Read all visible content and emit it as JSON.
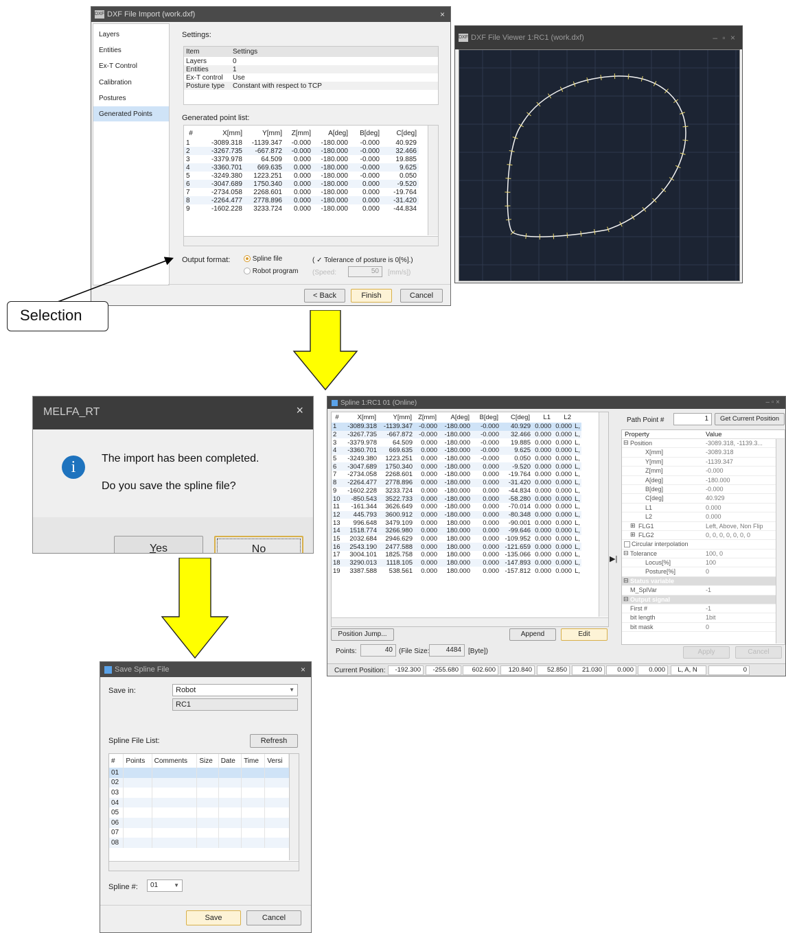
{
  "dxf_import": {
    "title": "DXF File Import (work.dxf)",
    "title_icon": "DXF",
    "close": "×",
    "nav": [
      "Layers",
      "Entities",
      "Ex-T Control",
      "Calibration",
      "Postures",
      "Generated Points"
    ],
    "settings_label": "Settings:",
    "settings_headers": [
      "Item",
      "Settings"
    ],
    "settings_rows": [
      [
        "Layers",
        "0"
      ],
      [
        "Entities",
        "1"
      ],
      [
        "Ex-T control",
        "Use"
      ],
      [
        "Posture type",
        "Constant with respect to TCP"
      ]
    ],
    "point_list_label": "Generated point list:",
    "point_headers": [
      "#",
      "X[mm]",
      "Y[mm]",
      "Z[mm]",
      "A[deg]",
      "B[deg]",
      "C[deg]"
    ],
    "point_rows": [
      [
        "1",
        "-3089.318",
        "-1139.347",
        "-0.000",
        "-180.000",
        "-0.000",
        "40.929"
      ],
      [
        "2",
        "-3267.735",
        "-667.872",
        "-0.000",
        "-180.000",
        "-0.000",
        "32.466"
      ],
      [
        "3",
        "-3379.978",
        "64.509",
        "0.000",
        "-180.000",
        "-0.000",
        "19.885"
      ],
      [
        "4",
        "-3360.701",
        "669.635",
        "0.000",
        "-180.000",
        "-0.000",
        "9.625"
      ],
      [
        "5",
        "-3249.380",
        "1223.251",
        "0.000",
        "-180.000",
        "-0.000",
        "0.050"
      ],
      [
        "6",
        "-3047.689",
        "1750.340",
        "0.000",
        "-180.000",
        "0.000",
        "-9.520"
      ],
      [
        "7",
        "-2734.058",
        "2268.601",
        "0.000",
        "-180.000",
        "0.000",
        "-19.764"
      ],
      [
        "8",
        "-2264.477",
        "2778.896",
        "0.000",
        "-180.000",
        "0.000",
        "-31.420"
      ],
      [
        "9",
        "-1602.228",
        "3233.724",
        "0.000",
        "-180.000",
        "0.000",
        "-44.834"
      ]
    ],
    "output_format_label": "Output format:",
    "option_spline": "Spline file",
    "option_robot": "Robot program",
    "tolerance_label": "( ✓ Tolerance of posture is 0[%].)",
    "speed_label": "(Speed:",
    "speed_value": "50",
    "speed_unit": "[mm/s])",
    "back": "< Back",
    "finish": "Finish",
    "cancel": "Cancel"
  },
  "selection_callout": "Selection",
  "viewer": {
    "title": "DXF File Viewer 1:RC1 (work.dxf)",
    "title_icon": "DXF",
    "controls": "–  ▫  ×"
  },
  "melfa": {
    "title": "MELFA_RT",
    "close": "×",
    "info_glyph": "i",
    "message1": "The import has been completed.",
    "message2": "Do you save the spline file?",
    "yes_key": "Y",
    "yes_rest": "es",
    "no_key": "N",
    "no_rest": "o"
  },
  "spline": {
    "title": "Spline 1:RC1 01 (Online)",
    "controls": "–  ▫  ×",
    "headers": [
      "#",
      "X[mm]",
      "Y[mm]",
      "Z[mm]",
      "A[deg]",
      "B[deg]",
      "C[deg]",
      "L1",
      "L2",
      ""
    ],
    "rows": [
      [
        "1",
        "-3089.318",
        "-1139.347",
        "-0.000",
        "-180.000",
        "-0.000",
        "40.929",
        "0.000",
        "0.000",
        "L,"
      ],
      [
        "2",
        "-3267.735",
        "-667.872",
        "-0.000",
        "-180.000",
        "-0.000",
        "32.466",
        "0.000",
        "0.000",
        "L,"
      ],
      [
        "3",
        "-3379.978",
        "64.509",
        "0.000",
        "-180.000",
        "-0.000",
        "19.885",
        "0.000",
        "0.000",
        "L,"
      ],
      [
        "4",
        "-3360.701",
        "669.635",
        "0.000",
        "-180.000",
        "-0.000",
        "9.625",
        "0.000",
        "0.000",
        "L,"
      ],
      [
        "5",
        "-3249.380",
        "1223.251",
        "0.000",
        "-180.000",
        "-0.000",
        "0.050",
        "0.000",
        "0.000",
        "L,"
      ],
      [
        "6",
        "-3047.689",
        "1750.340",
        "0.000",
        "-180.000",
        "0.000",
        "-9.520",
        "0.000",
        "0.000",
        "L,"
      ],
      [
        "7",
        "-2734.058",
        "2268.601",
        "0.000",
        "-180.000",
        "0.000",
        "-19.764",
        "0.000",
        "0.000",
        "L,"
      ],
      [
        "8",
        "-2264.477",
        "2778.896",
        "0.000",
        "-180.000",
        "0.000",
        "-31.420",
        "0.000",
        "0.000",
        "L,"
      ],
      [
        "9",
        "-1602.228",
        "3233.724",
        "0.000",
        "-180.000",
        "0.000",
        "-44.834",
        "0.000",
        "0.000",
        "L,"
      ],
      [
        "10",
        "-850.543",
        "3522.733",
        "0.000",
        "-180.000",
        "0.000",
        "-58.280",
        "0.000",
        "0.000",
        "L,"
      ],
      [
        "11",
        "-161.344",
        "3626.649",
        "0.000",
        "-180.000",
        "0.000",
        "-70.014",
        "0.000",
        "0.000",
        "L,"
      ],
      [
        "12",
        "445.793",
        "3600.912",
        "0.000",
        "-180.000",
        "0.000",
        "-80.348",
        "0.000",
        "0.000",
        "L,"
      ],
      [
        "13",
        "996.648",
        "3479.109",
        "0.000",
        "180.000",
        "0.000",
        "-90.001",
        "0.000",
        "0.000",
        "L,"
      ],
      [
        "14",
        "1518.774",
        "3266.980",
        "0.000",
        "180.000",
        "0.000",
        "-99.646",
        "0.000",
        "0.000",
        "L,"
      ],
      [
        "15",
        "2032.684",
        "2946.629",
        "0.000",
        "180.000",
        "0.000",
        "-109.952",
        "0.000",
        "0.000",
        "L,"
      ],
      [
        "16",
        "2543.190",
        "2477.588",
        "0.000",
        "180.000",
        "0.000",
        "-121.659",
        "0.000",
        "0.000",
        "L,"
      ],
      [
        "17",
        "3004.101",
        "1825.758",
        "0.000",
        "180.000",
        "0.000",
        "-135.066",
        "0.000",
        "0.000",
        "L,"
      ],
      [
        "18",
        "3290.013",
        "1118.105",
        "0.000",
        "180.000",
        "0.000",
        "-147.893",
        "0.000",
        "0.000",
        "L,"
      ],
      [
        "19",
        "3387.588",
        "538.561",
        "0.000",
        "180.000",
        "0.000",
        "-157.812",
        "0.000",
        "0.000",
        "L,"
      ]
    ],
    "position_jump": "Position Jump...",
    "append": "Append",
    "edit": "Edit",
    "points_label": "Points:",
    "points_value": "40",
    "file_size_label": "(File Size:",
    "file_size_value": "4484",
    "file_size_unit": "[Byte])",
    "path_point_label": "Path Point #",
    "path_point_value": "1",
    "get_current_position": "Get Current Position",
    "prop_headers": [
      "Property",
      "Value"
    ],
    "properties": [
      {
        "sign": "⊟",
        "name": "Position",
        "value": "-3089.318, -1139.3...",
        "indent": 0,
        "kind": "row"
      },
      {
        "sign": "",
        "name": "X[mm]",
        "value": "-3089.318",
        "indent": 2,
        "kind": "row"
      },
      {
        "sign": "",
        "name": "Y[mm]",
        "value": "-1139.347",
        "indent": 2,
        "kind": "row"
      },
      {
        "sign": "",
        "name": "Z[mm]",
        "value": "-0.000",
        "indent": 2,
        "kind": "row"
      },
      {
        "sign": "",
        "name": "A[deg]",
        "value": "-180.000",
        "indent": 2,
        "kind": "row"
      },
      {
        "sign": "",
        "name": "B[deg]",
        "value": "-0.000",
        "indent": 2,
        "kind": "row"
      },
      {
        "sign": "",
        "name": "C[deg]",
        "value": "40.929",
        "indent": 2,
        "kind": "row"
      },
      {
        "sign": "",
        "name": "L1",
        "value": "0.000",
        "indent": 2,
        "kind": "row"
      },
      {
        "sign": "",
        "name": "L2",
        "value": "0.000",
        "indent": 2,
        "kind": "row"
      },
      {
        "sign": "⊞",
        "name": "FLG1",
        "value": "Left, Above, Non Flip",
        "indent": 1,
        "kind": "row"
      },
      {
        "sign": "⊞",
        "name": "FLG2",
        "value": "0, 0, 0, 0, 0, 0, 0",
        "indent": 1,
        "kind": "row"
      },
      {
        "sign": "",
        "name": "Circular interpolation",
        "value": "",
        "indent": 0,
        "kind": "check"
      },
      {
        "sign": "⊟",
        "name": "Tolerance",
        "value": "100, 0",
        "indent": 0,
        "kind": "row"
      },
      {
        "sign": "",
        "name": "Locus[%]",
        "value": "100",
        "indent": 2,
        "kind": "row"
      },
      {
        "sign": "",
        "name": "Posture[%]",
        "value": "0",
        "indent": 2,
        "kind": "row"
      },
      {
        "sign": "⊟",
        "name": "Status variable",
        "value": "",
        "indent": 0,
        "kind": "cat"
      },
      {
        "sign": "",
        "name": "M_SplVar",
        "value": "-1",
        "indent": 1,
        "kind": "row"
      },
      {
        "sign": "⊟",
        "name": "Output signal",
        "value": "",
        "indent": 0,
        "kind": "cat"
      },
      {
        "sign": "",
        "name": "First #",
        "value": "-1",
        "indent": 1,
        "kind": "row"
      },
      {
        "sign": "",
        "name": "bit length",
        "value": "1bit",
        "indent": 1,
        "kind": "row"
      },
      {
        "sign": "",
        "name": "bit mask",
        "value": "0",
        "indent": 1,
        "kind": "row"
      }
    ],
    "apply": "Apply",
    "cancel": "Cancel",
    "current_position_label": "Current Position:",
    "current_position": [
      "-192.300",
      "-255.680",
      "602.600",
      "120.840",
      "52.850",
      "21.030",
      "0.000",
      "0.000",
      "L, A, N",
      "0"
    ]
  },
  "save_spline": {
    "title": "Save Spline File",
    "close": "×",
    "save_in_label": "Save in:",
    "save_in_value": "Robot",
    "save_in_sub": "RC1",
    "list_label": "Spline File List:",
    "refresh": "Refresh",
    "headers": [
      "#",
      "Points",
      "Comments",
      "Size",
      "Date",
      "Time",
      "Versi"
    ],
    "rows": [
      "01",
      "02",
      "03",
      "04",
      "05",
      "06",
      "07",
      "08"
    ],
    "spline_no_label": "Spline #:",
    "spline_no_value": "01",
    "save": "Save",
    "cancel": "Cancel"
  },
  "colors": {
    "arrow": "#ffff00",
    "accent": "#3b82c4",
    "highlight_row": "#cfe3f7",
    "finish_border": "#d8b04a",
    "viewer_bg": "#1c2433"
  }
}
